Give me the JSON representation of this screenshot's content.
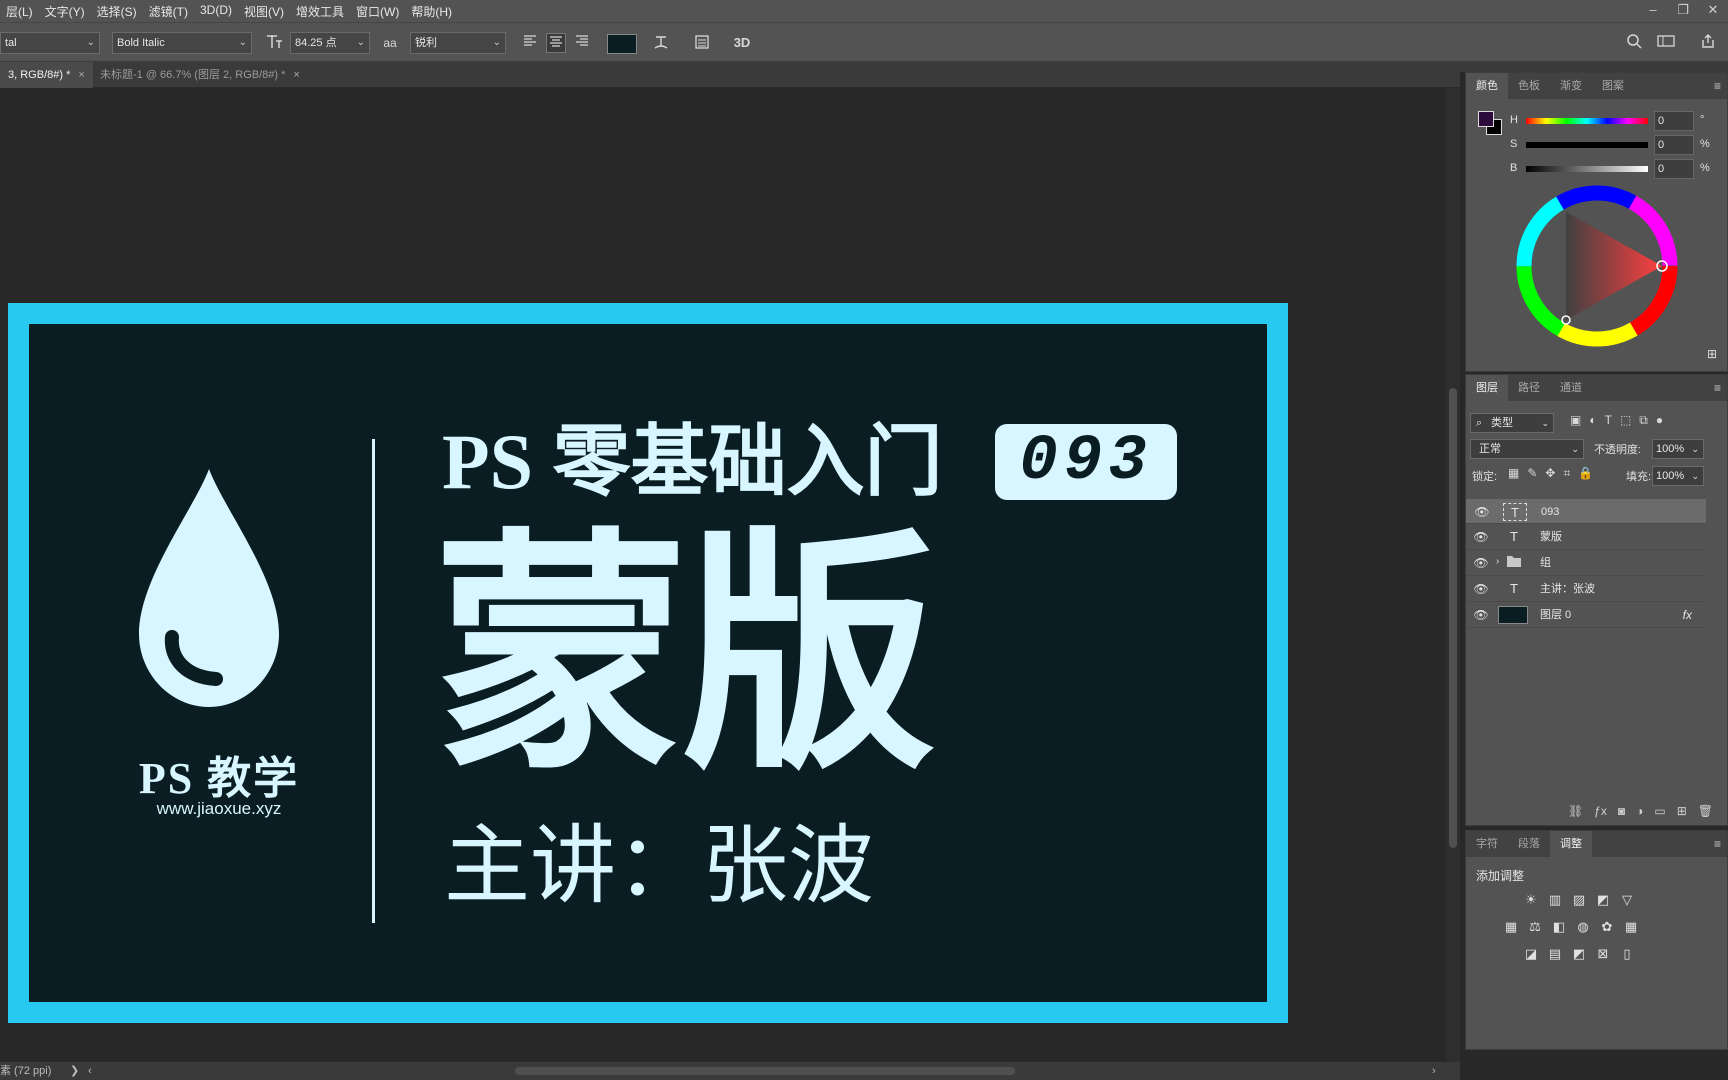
{
  "menubar": {
    "items": [
      "层(L)",
      "文字(Y)",
      "选择(S)",
      "滤镜(T)",
      "3D(D)",
      "视图(V)",
      "增效工具",
      "窗口(W)",
      "帮助(H)"
    ],
    "window_controls": [
      "–",
      "❐",
      "✕"
    ]
  },
  "options_bar": {
    "font_family": "tal",
    "font_style": "Bold Italic",
    "font_size": "84.25 点",
    "antialias_label": "aa",
    "antialias": "锐利",
    "text_color": "#0a1d23",
    "threed_label": "3D"
  },
  "doc_tabs": [
    {
      "label": "3, RGB/8#) *",
      "close": "×"
    },
    {
      "label": "未标题-1 @ 66.7% (图层 2, RGB/8#) *",
      "close": "×"
    }
  ],
  "artwork": {
    "logo_name": "PS 教学",
    "logo_url": "www.jiaoxue.xyz",
    "title": "PS 零基础入门",
    "badge": "093",
    "big_title": "蒙版",
    "speaker": "主讲：张波",
    "border_color": "#27c9f0",
    "background_color": "#0a1d23",
    "text_color": "#d8f6ff"
  },
  "status_bar": {
    "text": "素 (72 ppi)",
    "arrow": "❯",
    "scroll_left": "‹",
    "scroll_right": "›"
  },
  "color_panel": {
    "tabs": [
      "颜色",
      "色板",
      "渐变",
      "图案"
    ],
    "h": {
      "label": "H",
      "value": "0",
      "unit": "°"
    },
    "s": {
      "label": "S",
      "value": "0",
      "unit": "%"
    },
    "b": {
      "label": "B",
      "value": "0",
      "unit": "%"
    },
    "foreground": "#2c0a3c",
    "background": "#000000"
  },
  "layers_panel": {
    "tabs": [
      "图层",
      "路径",
      "通道"
    ],
    "filter_kind": "类型",
    "blend_mode": "正常",
    "opacity_label": "不透明度:",
    "opacity": "100%",
    "lock_label": "锁定:",
    "fill_label": "填充:",
    "fill": "100%",
    "layers": [
      {
        "name": "093",
        "kind": "T",
        "selected": true
      },
      {
        "name": "蒙版",
        "kind": "T",
        "selected": false
      },
      {
        "name": "组",
        "kind": "folder",
        "selected": false
      },
      {
        "name": "主讲：张波",
        "kind": "T",
        "selected": false
      },
      {
        "name": "图层 0",
        "kind": "pixel",
        "selected": false,
        "fx": "fx"
      }
    ]
  },
  "adjust_panel": {
    "tabs": [
      "字符",
      "段落",
      "调整"
    ],
    "title": "添加调整"
  }
}
